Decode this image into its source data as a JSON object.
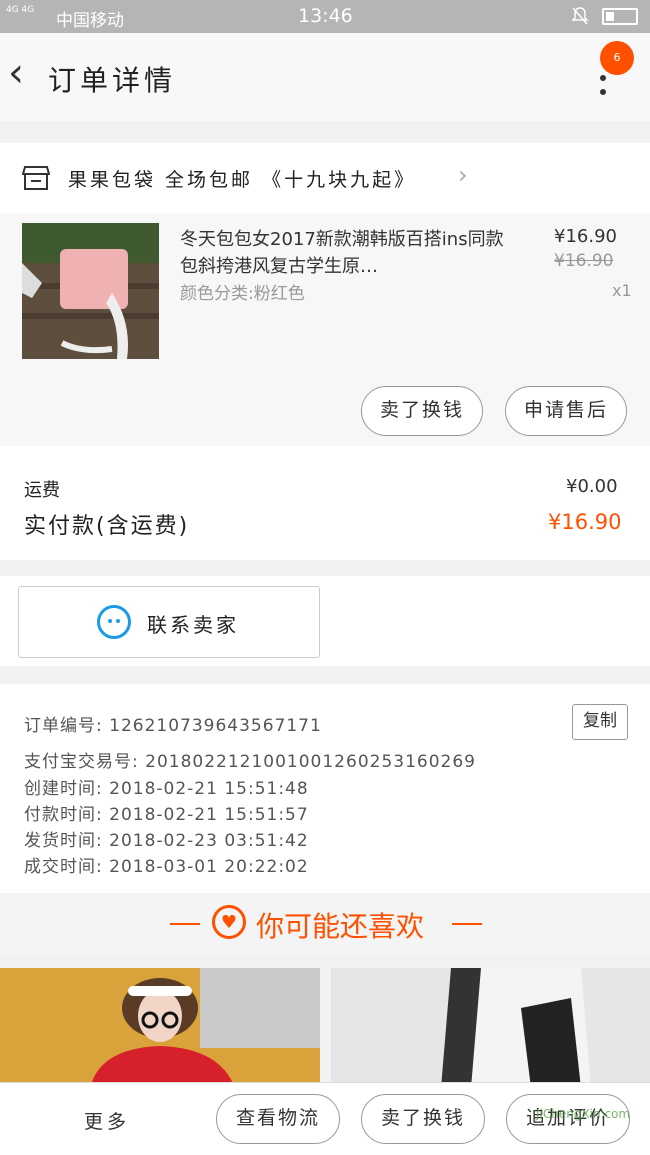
{
  "status": {
    "carrier": "中国移动",
    "signal": "4G 4G",
    "time": "13:46"
  },
  "nav": {
    "title": "订单详情",
    "badge": "6"
  },
  "shop": {
    "name": "果果包袋 全场包邮 《十九块九起》"
  },
  "item": {
    "title": "冬天包包女2017新款潮韩版百搭ins同款包斜挎港风复古学生原…",
    "sku": "颜色分类:粉红色",
    "price": "¥16.90",
    "original_price": "¥16.90",
    "quantity": "x1",
    "buttons": [
      "卖了换钱",
      "申请售后"
    ]
  },
  "fees": {
    "shipping_label": "运费",
    "shipping_value": "¥0.00",
    "paid_label": "实付款(含运费)",
    "paid_value": "¥16.90"
  },
  "contact": {
    "label": "联系卖家"
  },
  "order": {
    "copy_label": "复制",
    "rows": [
      "订单编号: 126210739643567171",
      "支付宝交易号: 2018022121001001260253160269",
      "创建时间: 2018-02-21 15:51:48",
      "付款时间: 2018-02-21 15:51:57",
      "发货时间: 2018-02-23 03:51:42",
      "成交时间: 2018-03-01 20:22:02"
    ]
  },
  "recommend": {
    "title": "你可能还喜欢"
  },
  "bottom": {
    "more": "更多",
    "buttons": [
      "查看物流",
      "卖了换钱",
      "追加评价"
    ],
    "watermark": "JiChengXin.com"
  },
  "colors": {
    "accent": "#ff5000",
    "contact_icon": "#1a9ae6"
  }
}
